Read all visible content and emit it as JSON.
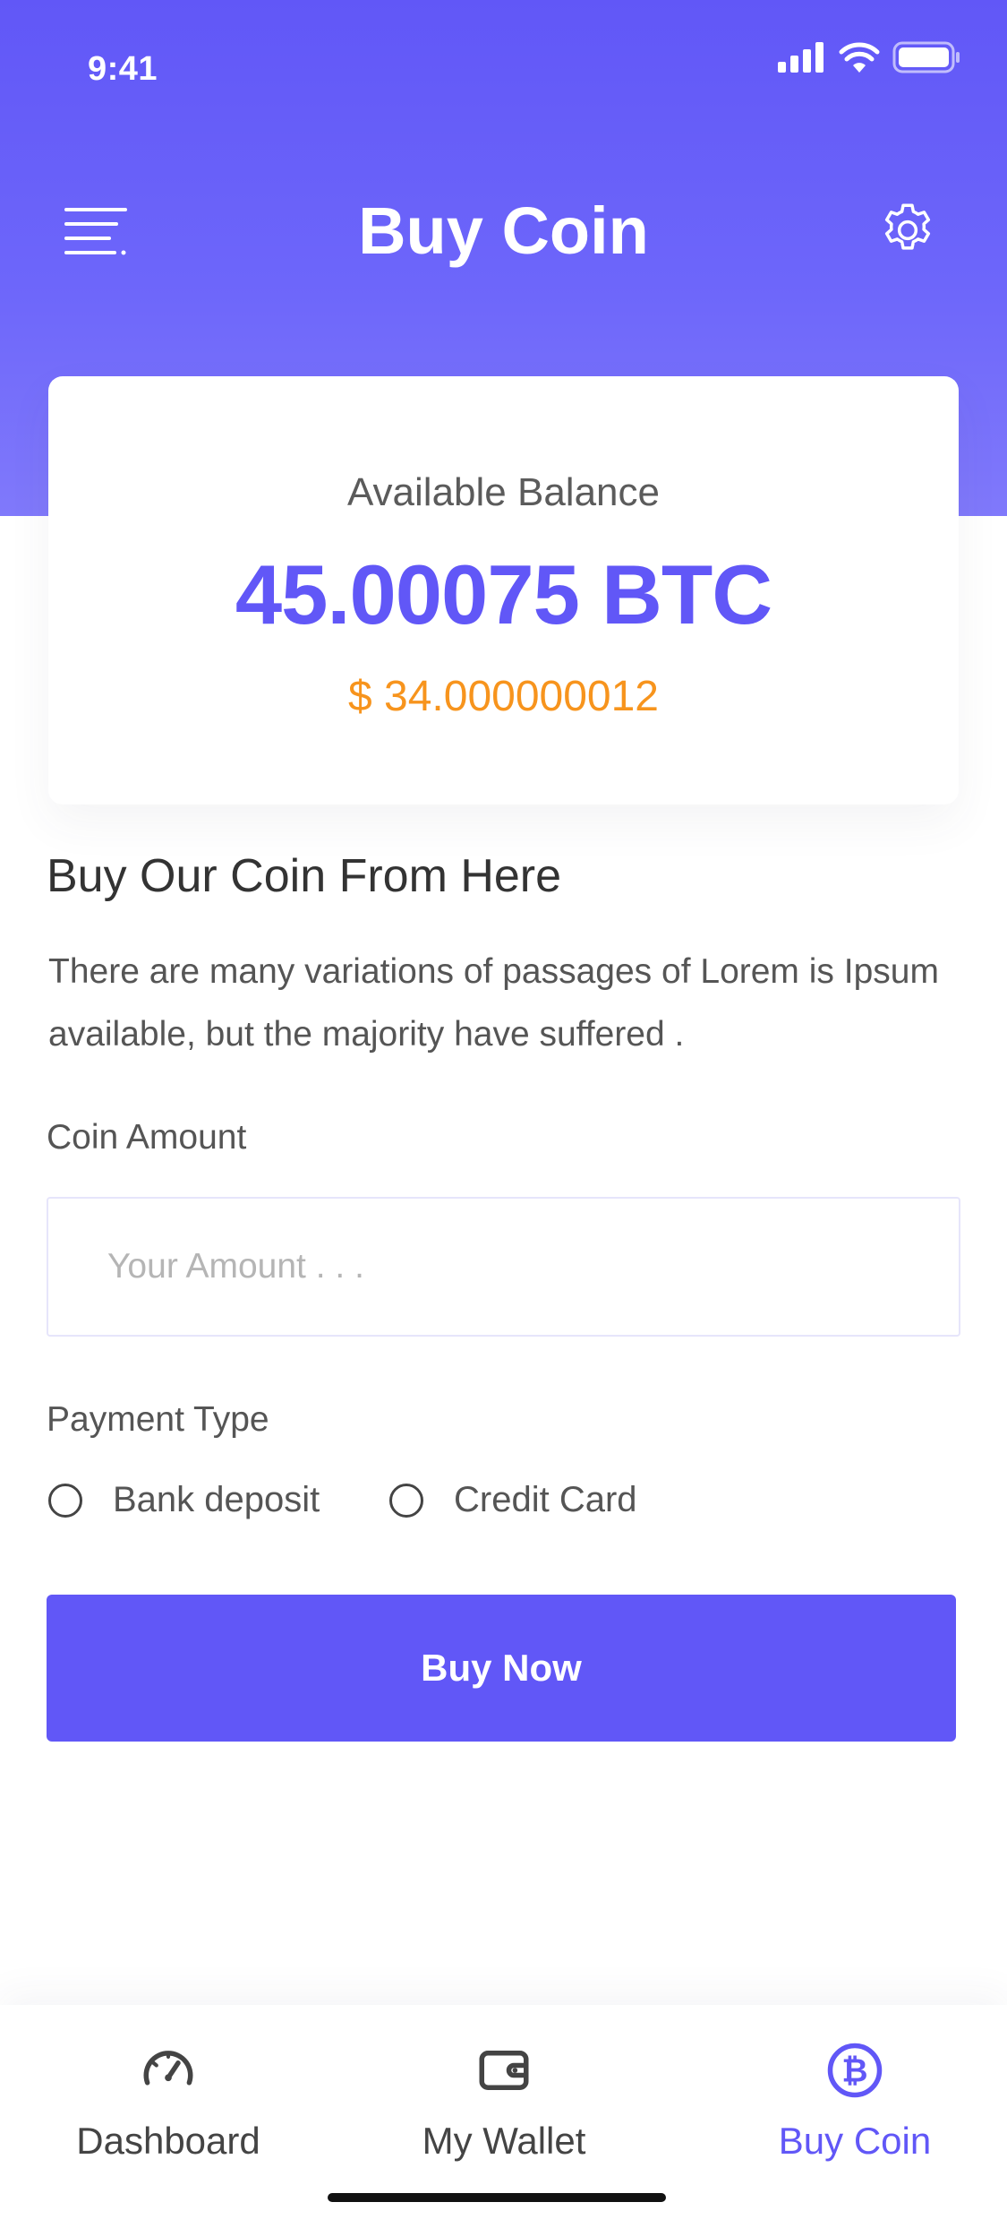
{
  "status_bar": {
    "time": "9:41"
  },
  "header": {
    "title": "Buy Coin",
    "menu_icon": "menu-icon",
    "settings_icon": "gear-icon"
  },
  "balance": {
    "label": "Available Balance",
    "btc": "45.00075 BTC",
    "usd": "$ 34.000000012"
  },
  "section": {
    "title": "Buy Our Coin From Here",
    "description": "There are many variations of passages of Lorem is Ipsum available, but the majority have suffered ."
  },
  "form": {
    "amount_label": "Coin Amount",
    "amount_placeholder": "Your Amount . . .",
    "amount_value": "",
    "payment_label": "Payment Type",
    "payment_options": [
      {
        "label": "Bank deposit",
        "selected": false
      },
      {
        "label": "Credit Card",
        "selected": false
      }
    ],
    "submit_label": "Buy Now"
  },
  "bottom_nav": {
    "items": [
      {
        "label": "Dashboard",
        "icon": "speedometer-icon",
        "active": false
      },
      {
        "label": "My Wallet",
        "icon": "wallet-icon",
        "active": false
      },
      {
        "label": "Buy Coin",
        "icon": "bitcoin-icon",
        "active": true
      }
    ]
  },
  "colors": {
    "accent": "#6157f7",
    "usd": "#f7941d",
    "text": "#333333"
  }
}
